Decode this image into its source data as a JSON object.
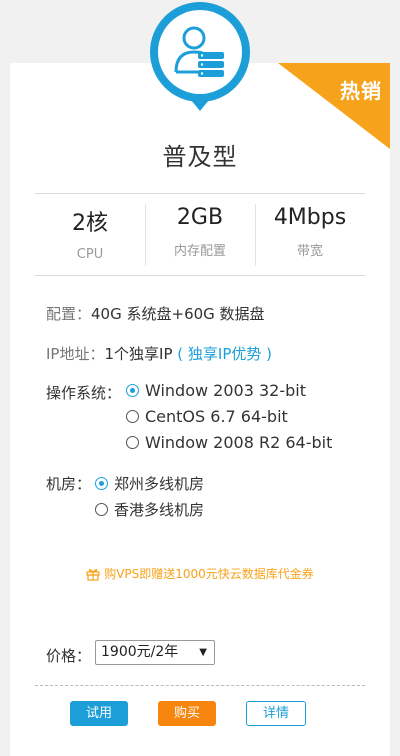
{
  "badge": "热销",
  "title": "普及型",
  "specs": [
    {
      "value": "2核",
      "label": "CPU"
    },
    {
      "value": "2GB",
      "label": "内存配置"
    },
    {
      "value": "4Mbps",
      "label": "带宽"
    }
  ],
  "config": {
    "key": "配置：",
    "value": "40G 系统盘+60G 数据盘"
  },
  "ip": {
    "key": "IP地址：",
    "value": "1个独享IP",
    "link": "( 独享IP优势 )"
  },
  "os": {
    "key": "操作系统：",
    "options": [
      "Window 2003 32-bit",
      "CentOS 6.7 64-bit",
      "Window 2008 R2 64-bit"
    ],
    "selected_index": 0
  },
  "room": {
    "key": "机房：",
    "options": [
      "郑州多线机房",
      "香港多线机房"
    ],
    "selected_index": 0
  },
  "promo": "购VPS即赠送1000元快云数据库代金券",
  "price": {
    "key": "价格：",
    "selected": "1900元/2年"
  },
  "buttons": {
    "try": "试用",
    "buy": "购买",
    "detail": "详情"
  },
  "colors": {
    "accent_blue": "#1c9fd8",
    "accent_orange": "#f7a21b"
  }
}
